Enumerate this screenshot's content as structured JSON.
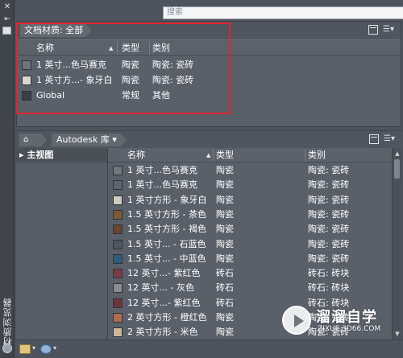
{
  "search": {
    "placeholder": "搜索"
  },
  "doc_panel": {
    "breadcrumb": "文档材质: 全部",
    "columns": [
      "名称",
      "类型",
      "类别"
    ],
    "rows": [
      {
        "name": "1 英寸...色马赛克",
        "type": "陶瓷",
        "category": "陶瓷: 瓷砖",
        "swatch": "#6f747b"
      },
      {
        "name": "1 英寸方...- 象牙白",
        "type": "陶瓷",
        "category": "陶瓷: 瓷砖",
        "swatch": "#d8d6d1"
      },
      {
        "name": "Global",
        "type": "常规",
        "category": "其他",
        "swatch": "#3b3f45"
      }
    ]
  },
  "library_panel": {
    "home_label": "⌂",
    "library_name": "Autodesk 库",
    "tree": [
      {
        "label": "主视图"
      }
    ],
    "columns": [
      "名称",
      "类型",
      "类别"
    ],
    "rows": [
      {
        "name": "1 英寸...色马赛克",
        "type": "陶瓷",
        "category": "陶瓷: 瓷砖",
        "swatch": "#717880"
      },
      {
        "name": "1 英寸...色马赛克",
        "type": "陶瓷",
        "category": "陶瓷: 瓷砖",
        "swatch": "#5d646c"
      },
      {
        "name": "1 英寸方形 - 象牙白",
        "type": "陶瓷",
        "category": "陶瓷: 瓷砖",
        "swatch": "#cfcbc3"
      },
      {
        "name": "1.5 英寸方形 - 茶色",
        "type": "陶瓷",
        "category": "陶瓷: 瓷砖",
        "swatch": "#7a5a2e"
      },
      {
        "name": "1.5 英寸方形 - 褐色",
        "type": "陶瓷",
        "category": "陶瓷: 瓷砖",
        "swatch": "#6a4430"
      },
      {
        "name": "1.5 英寸... - 石蓝色",
        "type": "陶瓷",
        "category": "陶瓷: 瓷砖",
        "swatch": "#4a5566"
      },
      {
        "name": "1.5 英寸... - 中蓝色",
        "type": "陶瓷",
        "category": "陶瓷: 瓷砖",
        "swatch": "#2f5c7a"
      },
      {
        "name": "12 英寸...- 紫红色",
        "type": "砖石",
        "category": "砖石: 砖块",
        "swatch": "#7a3b42"
      },
      {
        "name": "12 英寸... - 灰色",
        "type": "砖石",
        "category": "砖石: 砖块",
        "swatch": "#8a8d90"
      },
      {
        "name": "12 英寸...- 紫红色",
        "type": "砖石",
        "category": "砖石: 砖块",
        "swatch": "#6e3438"
      },
      {
        "name": "2 英寸方形 - 橙红色",
        "type": "陶瓷",
        "category": "陶瓷: 瓷砖",
        "swatch": "#b06b4e"
      },
      {
        "name": "2 英寸方形 - 米色",
        "type": "陶瓷",
        "category": "陶瓷: 瓷砖",
        "swatch": "#c9b79a"
      }
    ]
  },
  "sidebar": {
    "vertical_title": "材质浏览器"
  },
  "watermark": {
    "title": "溜溜自学",
    "url": "ZIXUE.3D66.COM"
  }
}
